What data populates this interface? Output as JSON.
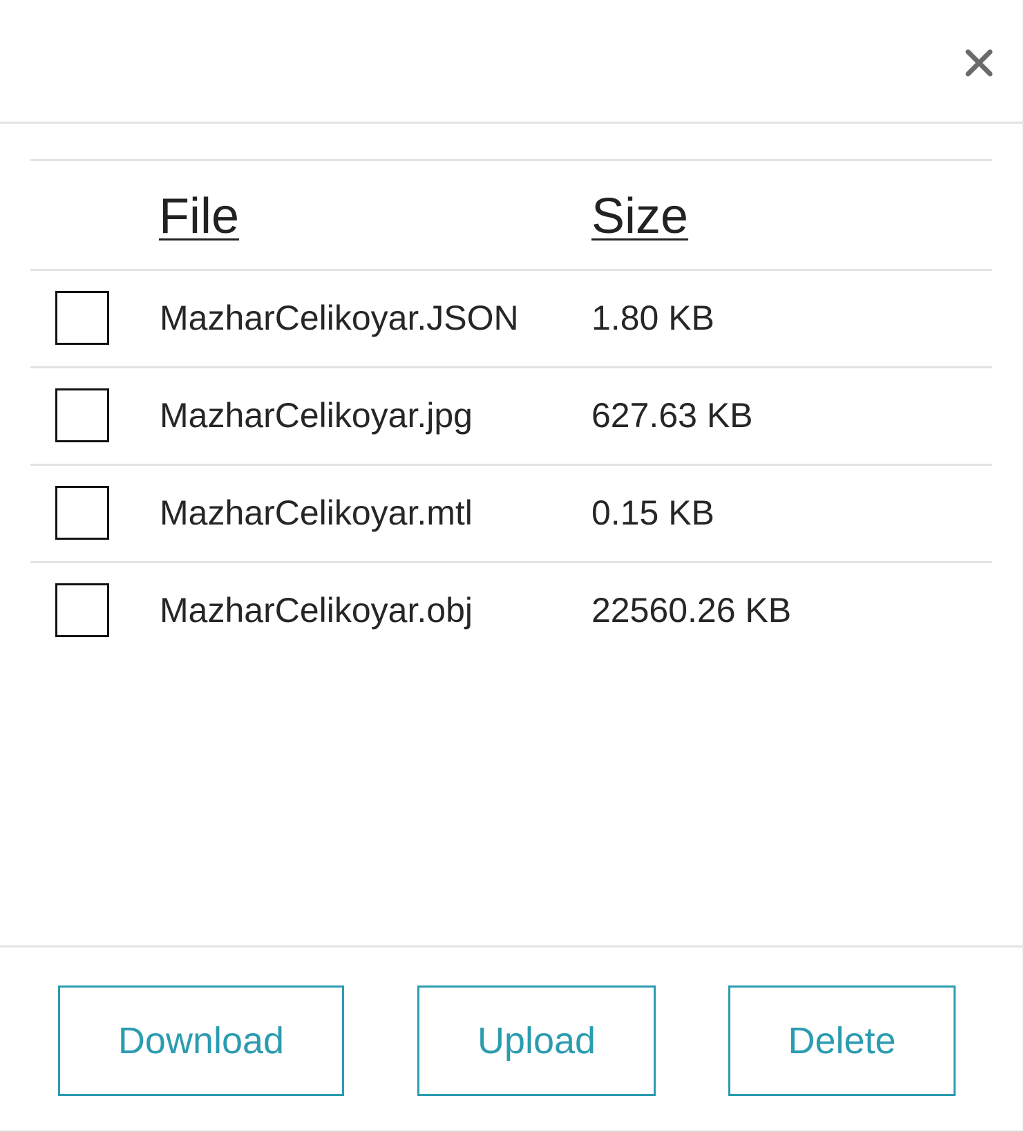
{
  "table": {
    "headers": {
      "file": "File",
      "size": "Size"
    },
    "rows": [
      {
        "name": "MazharCelikoyar.JSON",
        "size": "1.80 KB",
        "checked": false
      },
      {
        "name": "MazharCelikoyar.jpg",
        "size": "627.63 KB",
        "checked": false
      },
      {
        "name": "MazharCelikoyar.mtl",
        "size": "0.15 KB",
        "checked": false
      },
      {
        "name": "MazharCelikoyar.obj",
        "size": "22560.26 KB",
        "checked": false
      }
    ]
  },
  "footer": {
    "download_label": "Download",
    "upload_label": "Upload",
    "delete_label": "Delete"
  },
  "icons": {
    "close": "close-icon"
  },
  "colors": {
    "accent": "#2b9cb0",
    "divider": "#e3e3e3",
    "close_icon": "#6b6b6b"
  }
}
